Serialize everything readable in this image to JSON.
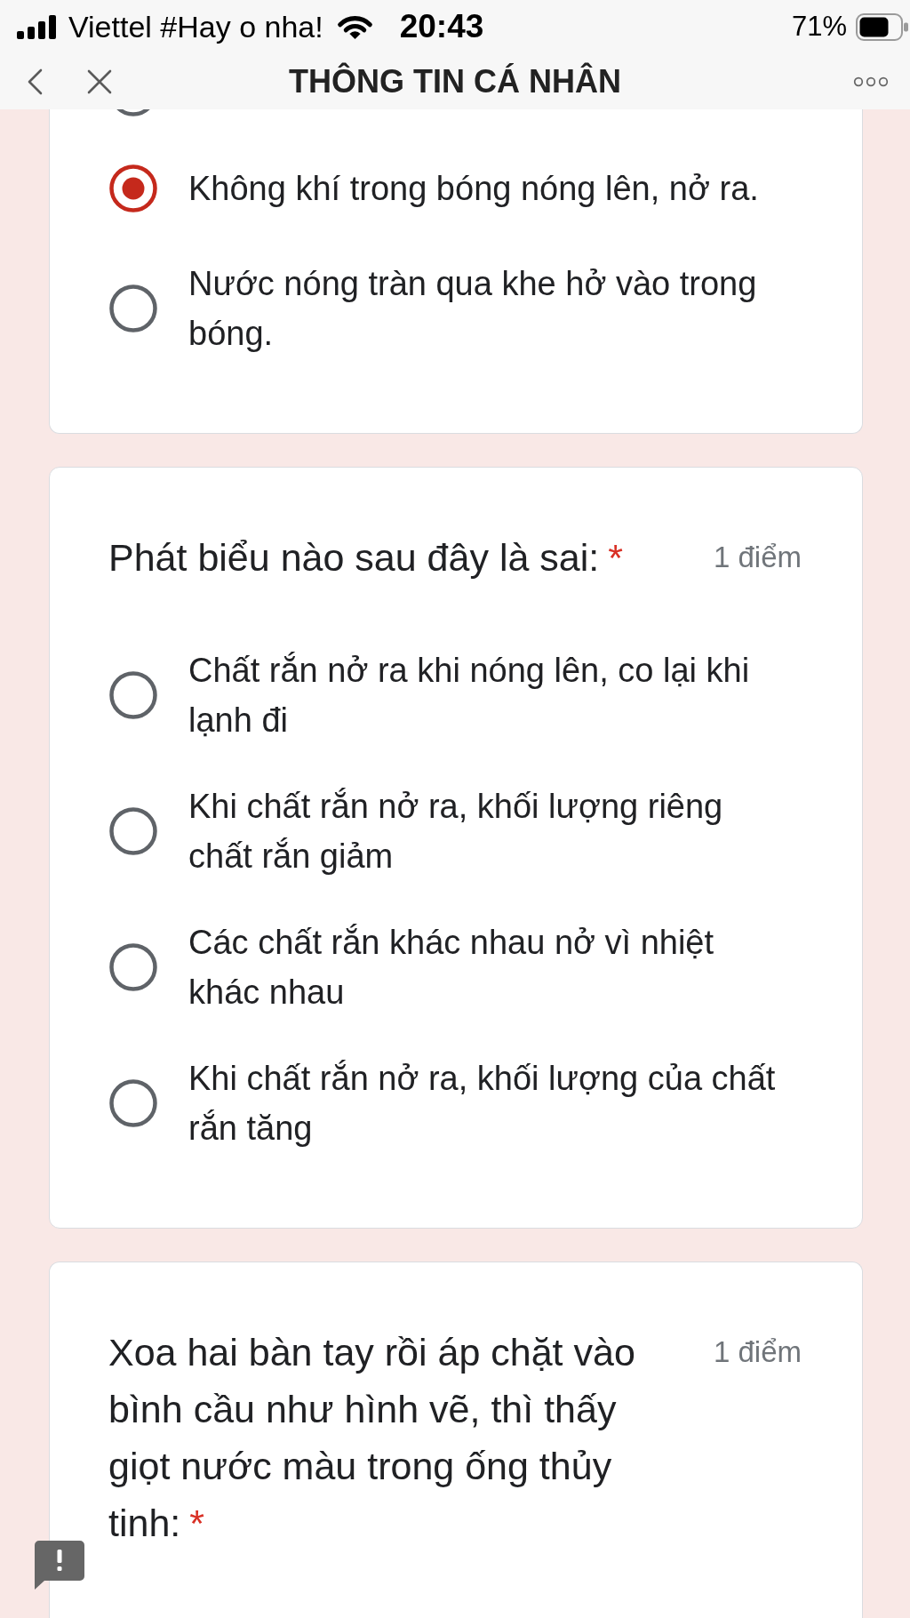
{
  "status_bar": {
    "carrier": "Viettel #Hay o nha!",
    "time": "20:43",
    "battery": "71%"
  },
  "nav_bar": {
    "title": "THÔNG TIN CÁ NHÂN"
  },
  "questions": [
    {
      "options": [
        {
          "kind": "cut-off",
          "selected": false
        },
        {
          "kind": "radio",
          "label": "Không khí trong bóng nóng lên, nở ra.",
          "selected": true
        },
        {
          "kind": "radio",
          "label": "Nước nóng tràn qua khe hở vào trong bóng.",
          "selected": false
        }
      ]
    },
    {
      "title": "Phát biểu nào sau đây là sai:",
      "required_mark": "*",
      "points": "1 điểm",
      "options": [
        {
          "kind": "radio",
          "label": "Chất rắn nở ra khi nóng lên, co lại khi lạnh đi",
          "selected": false
        },
        {
          "kind": "radio",
          "label": "Khi chất rắn nở ra, khối lượng riêng chất rắn giảm",
          "selected": false
        },
        {
          "kind": "radio",
          "label": "Các chất rắn khác nhau nở vì nhiệt khác nhau",
          "selected": false
        },
        {
          "kind": "radio",
          "label": "Khi chất rắn nở ra, khối lượng của chất rắn tăng",
          "selected": false
        }
      ]
    },
    {
      "title": "Xoa hai bàn tay rồi áp chặt vào bình cầu như hình vẽ, thì thấy giọt nước màu trong ống thủy tinh:",
      "required_mark": "*",
      "points": "1 điểm"
    }
  ]
}
